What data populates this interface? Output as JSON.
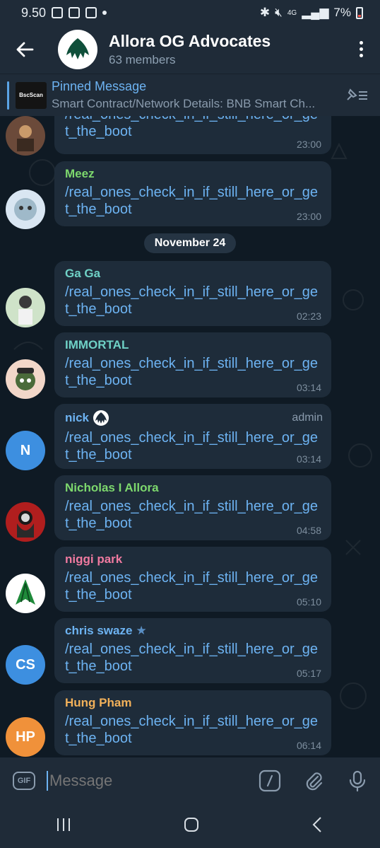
{
  "status_bar": {
    "time": "9.50",
    "battery": "7%",
    "network": "4G"
  },
  "header": {
    "title": "Allora OG Advocates",
    "subtitle": "63 members"
  },
  "pinned": {
    "title": "Pinned Message",
    "text": "Smart Contract/Network Details: BNB Smart Ch...",
    "thumb_label": "BscScan"
  },
  "date_separator": "November 24",
  "messages": [
    {
      "sender": "",
      "text": "/real_ones_check_in_if_still_here_or_get_the_boot",
      "time": "23:00"
    },
    {
      "sender": "Meez",
      "text": "/real_ones_check_in_if_still_here_or_get_the_boot",
      "time": "23:00"
    },
    {
      "sender": "Ga Ga",
      "text": "/real_ones_check_in_if_still_here_or_get_the_boot",
      "time": "02:23"
    },
    {
      "sender": "IMMORTAL",
      "text": "/real_ones_check_in_if_still_here_or_get_the_boot",
      "time": "03:14"
    },
    {
      "sender": "nick",
      "badge": "admin",
      "text": "/real_ones_check_in_if_still_here_or_get_the_boot",
      "time": "03:14",
      "avatar_initials": "N"
    },
    {
      "sender": "Nicholas I Allora",
      "text": "/real_ones_check_in_if_still_here_or_get_the_boot",
      "time": "04:58"
    },
    {
      "sender": "niggi park",
      "text": "/real_ones_check_in_if_still_here_or_get_the_boot",
      "time": "05:10"
    },
    {
      "sender": "chris swaze",
      "text": "/real_ones_check_in_if_still_here_or_get_the_boot",
      "time": "05:17",
      "avatar_initials": "CS"
    },
    {
      "sender": "Hung Pham",
      "text": "/real_ones_check_in_if_still_here_or_get_the_boot",
      "time": "06:14",
      "avatar_initials": "HP"
    }
  ],
  "composer": {
    "placeholder": "Message",
    "gif_label": "GIF"
  },
  "colors": {
    "accent": "#6db3f2",
    "meez": "#7dd86d",
    "gaga": "#6fd1c6",
    "immortal": "#6fd1c6",
    "nick": "#6db3f2",
    "nicholas": "#7dd86d",
    "niggi": "#f07aa0",
    "chris": "#6db3f2",
    "hung": "#f2b15a"
  }
}
